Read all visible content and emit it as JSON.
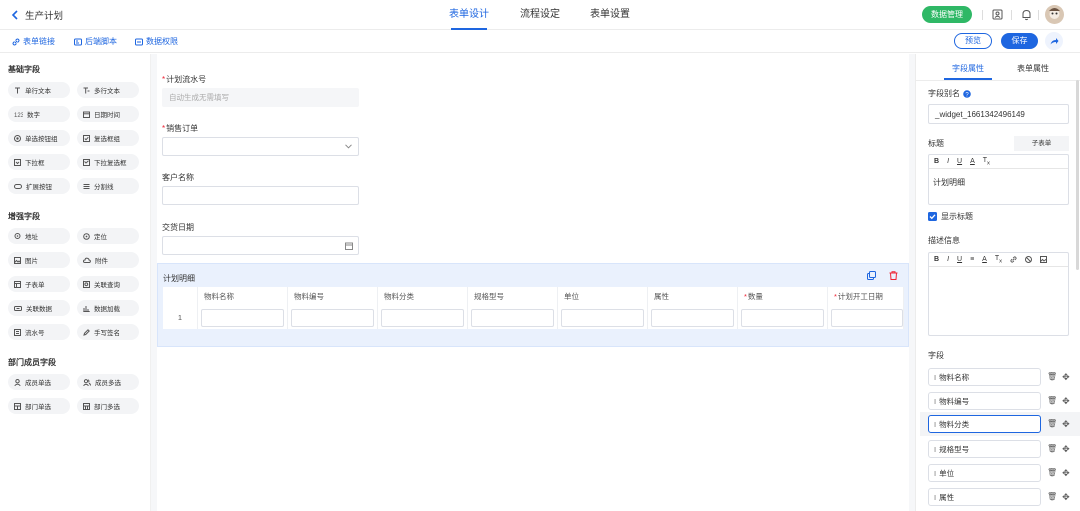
{
  "header": {
    "back_label": "生产计划",
    "tabs": [
      {
        "label": "表单设计",
        "active": true
      },
      {
        "label": "流程设定",
        "active": false
      },
      {
        "label": "表单设置",
        "active": false
      }
    ],
    "data_manage_label": "数据管理",
    "accent_color": "#1e66e0",
    "data_manage_color": "#2fb866"
  },
  "toolbar": {
    "links": [
      "表单链接",
      "后端脚本",
      "数据权限"
    ],
    "preview_label": "预览",
    "save_label": "保存"
  },
  "left_panel": {
    "basic": {
      "title": "基础字段",
      "items": [
        "单行文本",
        "多行文本",
        "数字",
        "日期时间",
        "单选按钮组",
        "复选框组",
        "下拉框",
        "下拉复选框",
        "扩展按钮",
        "分割线"
      ]
    },
    "enhanced": {
      "title": "增强字段",
      "items": [
        "地址",
        "定位",
        "图片",
        "附件",
        "子表单",
        "关联查询",
        "关联数据",
        "数据加载",
        "流水号",
        "手写签名"
      ]
    },
    "member": {
      "title": "部门成员字段",
      "items": [
        "成员单选",
        "成员多选",
        "部门单选",
        "部门多选"
      ]
    }
  },
  "form": {
    "fields": [
      {
        "label": "计划流水号",
        "required": true,
        "placeholder": "自动生成无需填写"
      },
      {
        "label": "销售订单",
        "required": true
      },
      {
        "label": "客户名称",
        "required": false
      },
      {
        "label": "交货日期",
        "required": false
      }
    ],
    "subtable": {
      "title": "计划明细",
      "columns": [
        {
          "label": "物料名称",
          "required": false
        },
        {
          "label": "物料编号",
          "required": false
        },
        {
          "label": "物料分类",
          "required": false
        },
        {
          "label": "规格型号",
          "required": false
        },
        {
          "label": "单位",
          "required": false
        },
        {
          "label": "属性",
          "required": false
        },
        {
          "label": "数量",
          "required": true
        },
        {
          "label": "计划开工日期",
          "required": true
        }
      ],
      "row_number": "1"
    }
  },
  "right_panel": {
    "tabs": [
      "字段属性",
      "表单属性"
    ],
    "alias_label": "字段别名",
    "alias_value": "_widget_1661342496149",
    "title_label": "标题",
    "title_tag": "子表单",
    "title_value": "计划明细",
    "show_title_label": "显示标题",
    "show_title_checked": true,
    "desc_label": "描述信息",
    "fields_label": "字段",
    "fields": [
      "物料名称",
      "物料编号",
      "物料分类",
      "规格型号",
      "单位",
      "属性"
    ]
  }
}
